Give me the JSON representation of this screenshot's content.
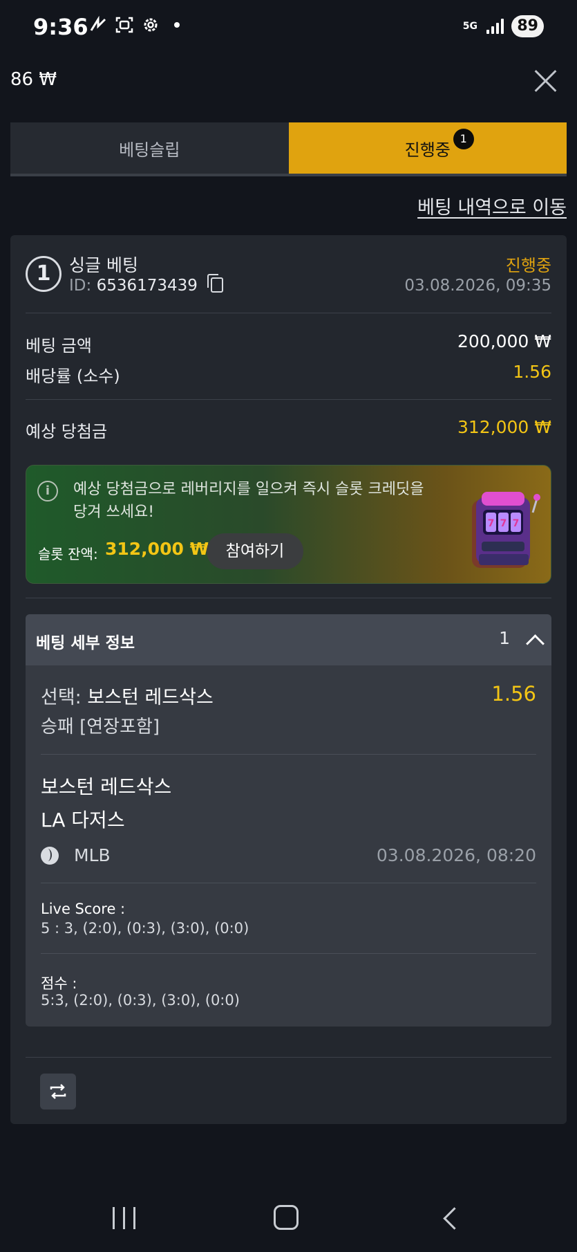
{
  "status_bar": {
    "time": "9:36",
    "network": "5G",
    "battery": "89",
    "icons": [
      "missed-call-icon",
      "screenshot-icon",
      "settings-gear-icon",
      "notification-dot-icon",
      "signal-icon"
    ]
  },
  "header": {
    "balance": "86 ₩"
  },
  "tabs": [
    {
      "label": "베팅슬립",
      "active": false
    },
    {
      "label": "진행중",
      "active": true,
      "badge": "1"
    }
  ],
  "history_link": "베팅 내역으로 이동",
  "bet": {
    "index": "1",
    "type": "싱글 베팅",
    "id_label": "ID:",
    "id_value": "6536173439",
    "status": "진행중",
    "datetime": "03.08.2026, 09:35",
    "stake_label": "베팅 금액",
    "stake_value": "200,000 ₩",
    "odds_label": "배당률 (소수)",
    "odds_value": "1.56",
    "payout_label": "예상 당첨금",
    "payout_value": "312,000 ₩"
  },
  "promo": {
    "text": "예상 당첨금으로 레버리지를 일으켜 즉시 슬롯 크레딧을 당겨 쓰세요!",
    "slot_label": "슬롯 잔액:",
    "slot_value": "312,000 ₩",
    "join_button": "참여하기"
  },
  "details": {
    "title": "베팅 세부 정보",
    "count": "1",
    "selection_label": "선택:",
    "selection_value": "보스턴 레드삭스",
    "selection_odds": "1.56",
    "market": "승패 [연장포함]",
    "team_home": "보스턴 레드삭스",
    "team_away": "LA 다저스",
    "league": "MLB",
    "match_datetime": "03.08.2026, 08:20",
    "live_score_label": "Live Score :",
    "live_score_value": "5 : 3, (2:0), (0:3), (3:0), (0:0)",
    "score_label": "점수 :",
    "score_value": "5:3, (2:0), (0:3), (3:0), (0:0)"
  },
  "colors": {
    "accent": "#e0a30f",
    "odds_yellow": "#f3c515",
    "background": "#12151c",
    "card": "#23272e"
  }
}
